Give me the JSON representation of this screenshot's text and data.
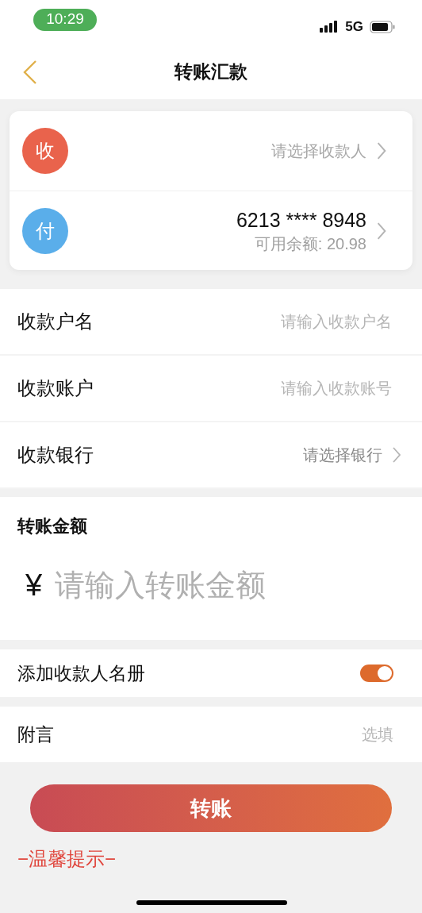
{
  "status_bar": {
    "time": "10:29",
    "network": "5G"
  },
  "nav": {
    "title": "转账汇款"
  },
  "parties": [
    {
      "avatar": "收",
      "color": "#e9634c",
      "kind": "payee",
      "placeholder": "请选择收款人"
    },
    {
      "avatar": "付",
      "color": "#5aaeea",
      "kind": "payer",
      "account": "6213 **** 8948",
      "balance": "可用余额: 20.98"
    }
  ],
  "fields": [
    {
      "label": "收款户名",
      "kind": "input",
      "placeholder": "请输入收款户名"
    },
    {
      "label": "收款账户",
      "kind": "input",
      "placeholder": "请输入收款账号"
    },
    {
      "label": "收款银行",
      "kind": "select",
      "value": "请选择银行"
    }
  ],
  "amount": {
    "label": "转账金额",
    "currency": "¥",
    "placeholder": "请输入转账金额"
  },
  "add_to_contacts": {
    "label": "添加收款人名册",
    "on": true
  },
  "note": {
    "label": "附言",
    "placeholder": "选填"
  },
  "submit": {
    "label": "转账"
  },
  "tips": {
    "title": "−温馨提示−"
  }
}
